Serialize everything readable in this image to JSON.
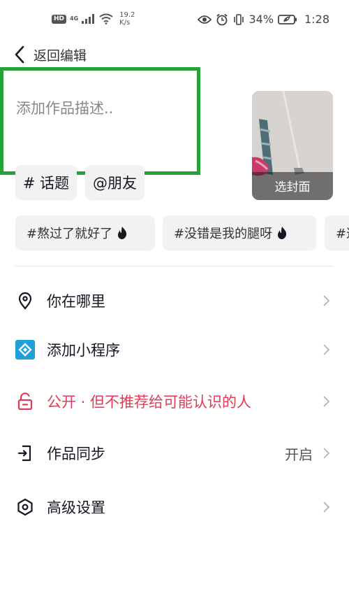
{
  "status_bar": {
    "hd": "HD",
    "network": "4G",
    "speed_value": "19.2",
    "speed_unit": "K/s",
    "battery": "34%",
    "time": "1:28"
  },
  "header": {
    "back_label": "返回编辑"
  },
  "description": {
    "placeholder": "添加作品描述.."
  },
  "cover": {
    "label": "选封面"
  },
  "chips": {
    "topic": "# 话题",
    "friends": "@朋友"
  },
  "topics": [
    "#熬过了就好了",
    "#没错是我的腿呀",
    "#这"
  ],
  "menu": [
    {
      "label": "你在哪里",
      "value": "",
      "icon": "location-pin-icon"
    },
    {
      "label": "添加小程序",
      "value": "",
      "icon": "mini-program-icon"
    },
    {
      "label": "公开 · 但不推荐给可能认识的人",
      "value": "",
      "icon": "unlock-icon"
    },
    {
      "label": "作品同步",
      "value": "开启",
      "icon": "sync-exit-icon"
    },
    {
      "label": "高级设置",
      "value": "",
      "icon": "hexagon-settings-icon"
    }
  ],
  "colors": {
    "highlight_border": "#25a23a",
    "danger": "#e23b58",
    "mini_program": "#1fa0d8"
  }
}
